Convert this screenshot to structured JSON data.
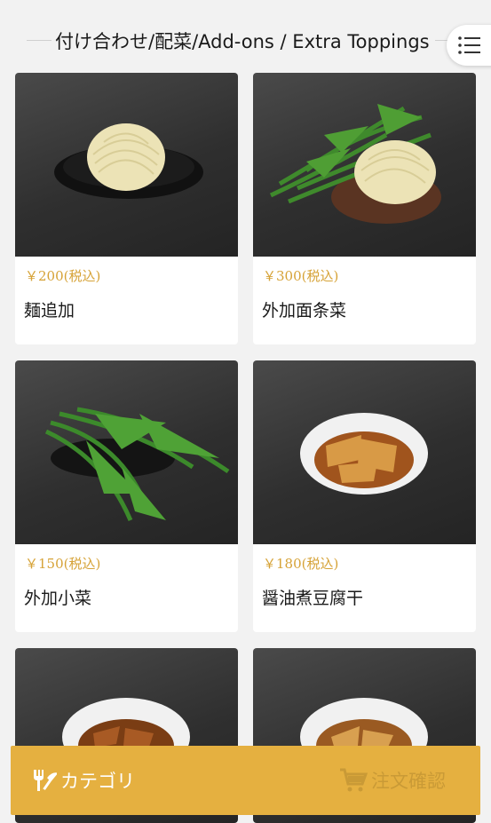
{
  "header": {
    "title": "付け合わせ/配菜/Add-ons / Extra Toppings",
    "menu_icon": "list-menu-icon"
  },
  "products": [
    {
      "price": "￥200(税込)",
      "name": "麺追加"
    },
    {
      "price": "￥300(税込)",
      "name": "外加面条菜"
    },
    {
      "price": "￥150(税込)",
      "name": "外加小菜"
    },
    {
      "price": "￥180(税込)",
      "name": "醤油煮豆腐干"
    },
    {
      "price": "",
      "name": ""
    },
    {
      "price": "",
      "name": ""
    }
  ],
  "bottom_bar": {
    "category_label": "カテゴリ",
    "category_icon": "utensils-icon",
    "order_label": "注文確認",
    "order_icon": "cart-icon"
  },
  "colors": {
    "accent": "#e5b040",
    "price": "#d6a236",
    "background": "#f2f2f2"
  }
}
